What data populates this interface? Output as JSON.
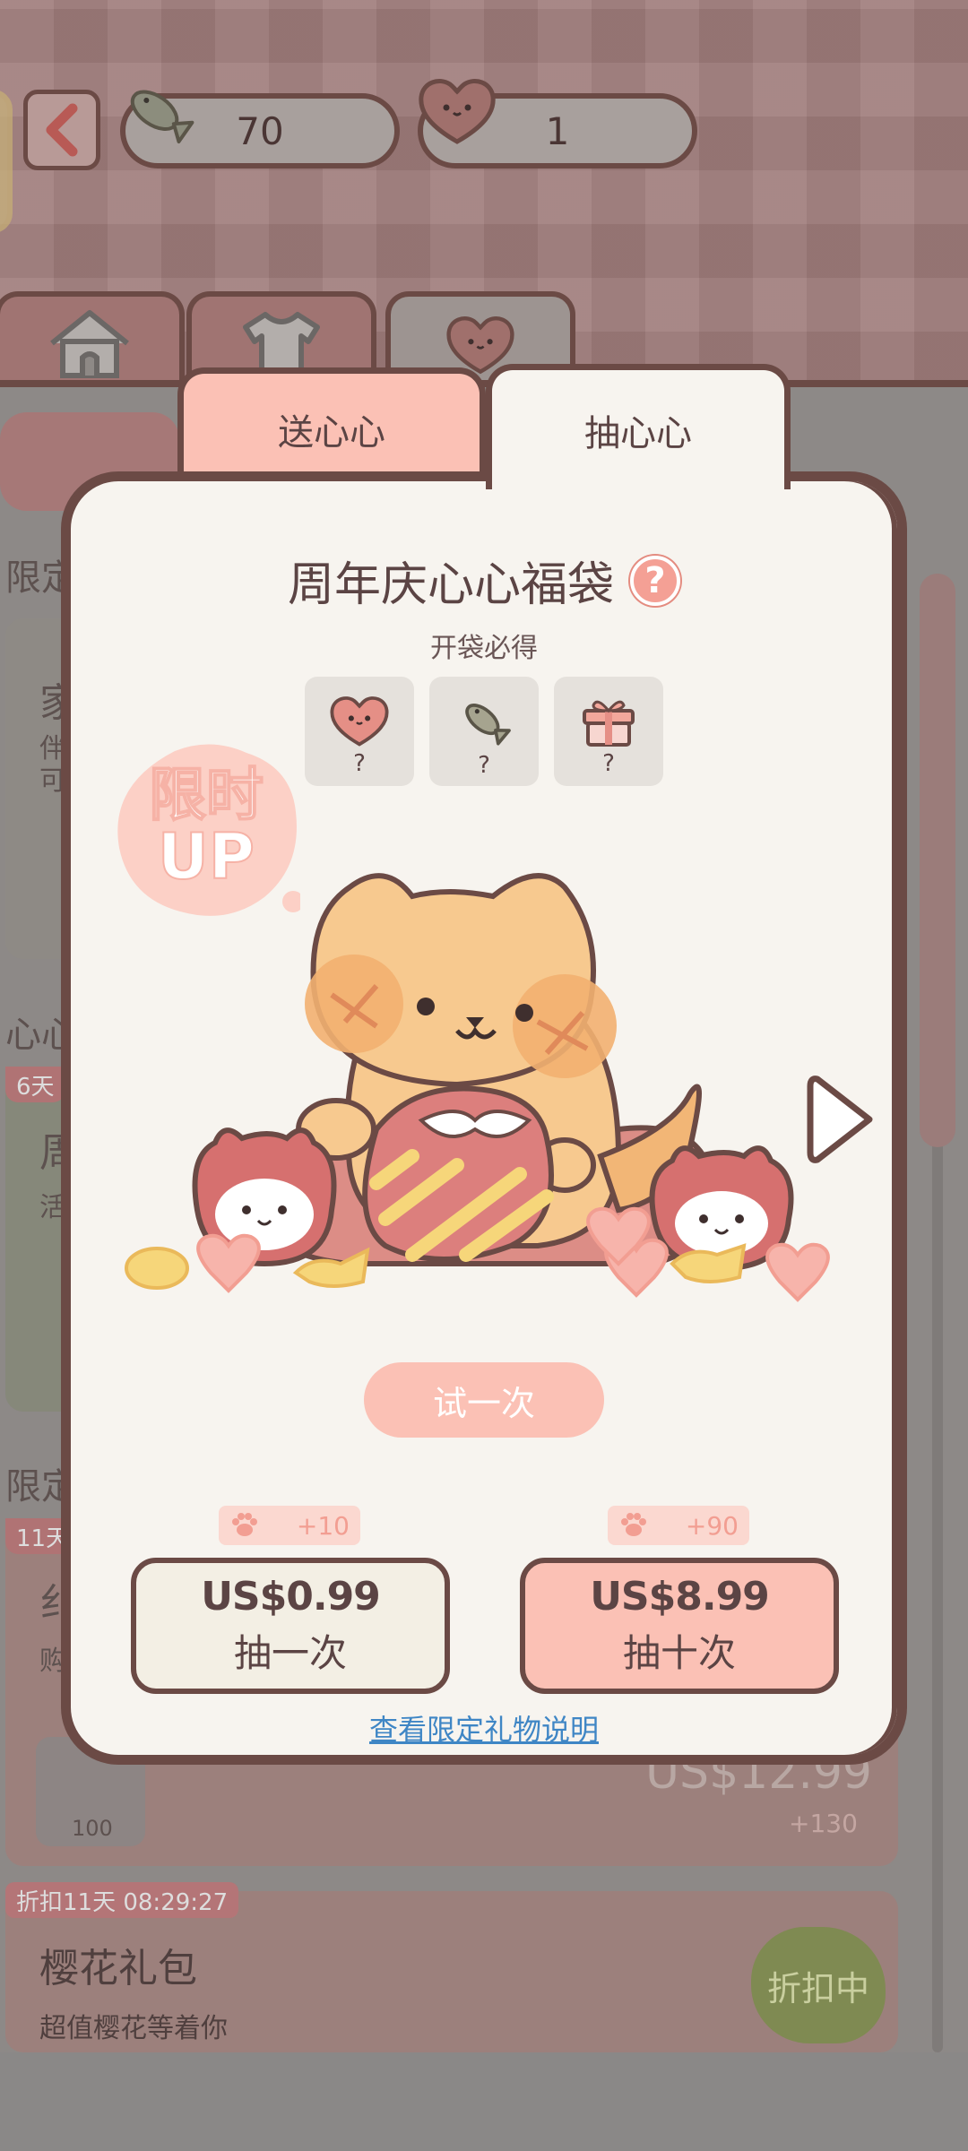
{
  "top_bar": {
    "fish_count": "70",
    "heart_count": "1"
  },
  "nav_tabs": [
    {
      "icon": "home-icon"
    },
    {
      "icon": "shirt-icon"
    },
    {
      "icon": "heart-face-icon"
    }
  ],
  "dialog": {
    "tabs": [
      {
        "label": "送心心",
        "active": false
      },
      {
        "label": "抽心心",
        "active": true
      }
    ],
    "title": "周年庆心心福袋",
    "help_label": "?",
    "subtitle": "开袋必得",
    "rewards": [
      {
        "icon": "heart-face-icon",
        "qty": "?"
      },
      {
        "icon": "fish-icon",
        "qty": "?"
      },
      {
        "icon": "gift-icon",
        "qty": "?"
      }
    ],
    "limited_badge": {
      "line1": "限时",
      "line2": "UP"
    },
    "try_button": "试一次",
    "offers": [
      {
        "bonus": "+10",
        "price": "US$0.99",
        "label": "抽一次"
      },
      {
        "bonus": "+90",
        "price": "US$8.99",
        "label": "抽十次"
      }
    ],
    "info_link": "查看限定礼物说明"
  },
  "background": {
    "section_limit": "限定",
    "section_heart": "心心",
    "section_limit2": "限定",
    "card1_title": "家",
    "card1_desc": "伴 可",
    "card2_badge": "6天",
    "card2_title": "周",
    "card2_desc": "活",
    "card3_badge": "11天",
    "card3_title": "纟",
    "card3_desc": "购",
    "card3_count": "100",
    "card3_price": "US$12.99",
    "card3_plus": "+130",
    "card4_badge": "折扣11天 08:29:27",
    "card4_title": "樱花礼包",
    "card4_desc": "超值樱花等着你",
    "card4_sale": "折扣中"
  },
  "colors": {
    "accent_pink": "#fbc1b5",
    "outline_brown": "#6b4a45",
    "panel_bg": "#f7f4ef",
    "link_blue": "#3f86c5"
  }
}
